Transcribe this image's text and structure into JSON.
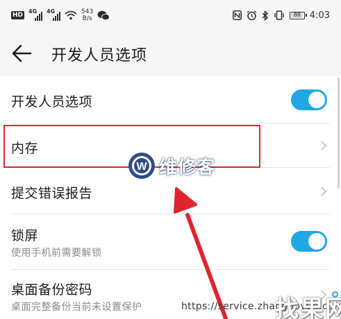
{
  "status_bar": {
    "hd_label": "HD",
    "signal1_label": "4G",
    "signal2_label": "4G",
    "net_speed_value": "543",
    "net_speed_unit": "B/s",
    "battery_level": "88",
    "time": "4:03"
  },
  "header": {
    "title": "开发人员选项"
  },
  "rows": [
    {
      "label": "开发人员选项",
      "toggle_on": true
    },
    {
      "label": "内存"
    },
    {
      "label": "提交错误报告"
    },
    {
      "label": "锁屏",
      "sublabel": "使用手机前需要解锁",
      "toggle_on": true
    },
    {
      "label": "桌面备份密码",
      "sublabel": "桌面完整备份当前未设置保护"
    }
  ],
  "annotations": {
    "highlight_color": "#e0252e",
    "arrow_color": "#e0252e"
  },
  "watermarks": {
    "center_logo_letter": "W",
    "center_text": "维修客",
    "url": "https://service.zhaoguoyun.com",
    "brand": "找果网"
  },
  "colors": {
    "toggle_on": "#1ea7e1",
    "header_bg": "#f6f6f6"
  }
}
